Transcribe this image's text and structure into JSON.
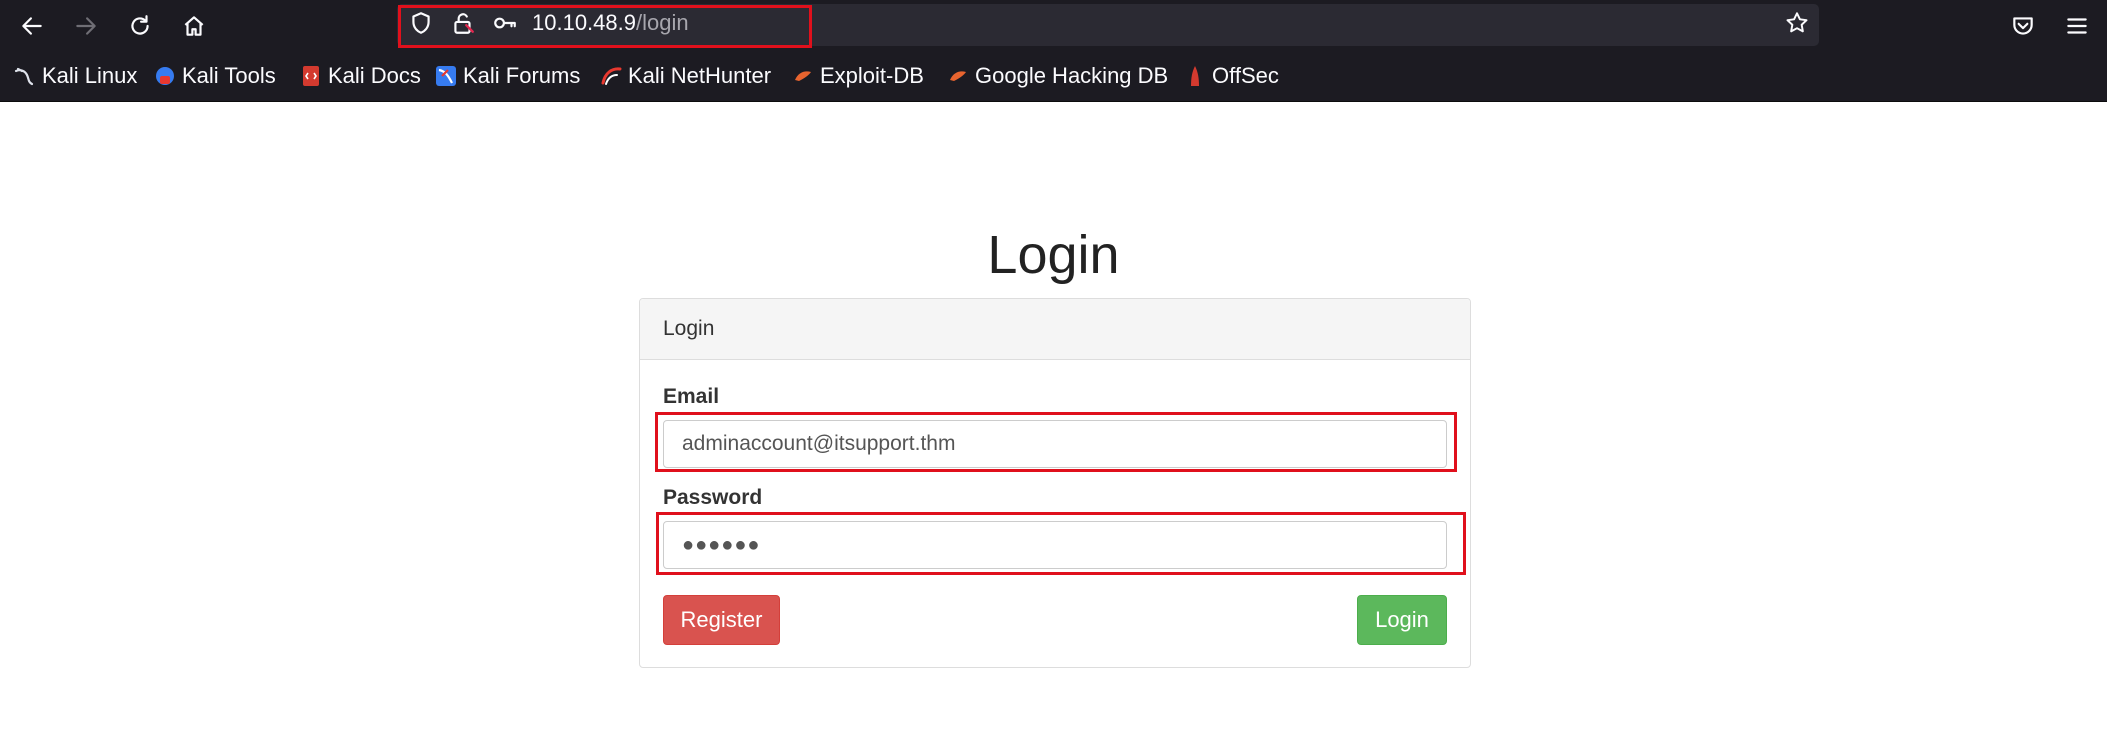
{
  "browser": {
    "url": {
      "host": "10.10.48.9",
      "path": "/login"
    },
    "bookmarks": [
      {
        "label": "Kali Linux",
        "icon": "kali-dragon-icon"
      },
      {
        "label": "Kali Tools",
        "icon": "kali-tools-icon"
      },
      {
        "label": "Kali Docs",
        "icon": "kali-docs-icon"
      },
      {
        "label": "Kali Forums",
        "icon": "kali-forums-icon"
      },
      {
        "label": "Kali NetHunter",
        "icon": "kali-nethunter-icon"
      },
      {
        "label": "Exploit-DB",
        "icon": "exploit-db-icon"
      },
      {
        "label": "Google Hacking DB",
        "icon": "ghdb-icon"
      },
      {
        "label": "OffSec",
        "icon": "offsec-icon"
      }
    ]
  },
  "page": {
    "title": "Login",
    "panel_heading": "Login",
    "email": {
      "label": "Email",
      "value": "adminaccount@itsupport.thm"
    },
    "password": {
      "label": "Password",
      "value": "●●●●●●"
    },
    "register_label": "Register",
    "login_label": "Login"
  },
  "colors": {
    "highlight": "#e0101c",
    "register": "#d9534f",
    "login": "#5cb85c",
    "chrome": "#1c1b22"
  }
}
